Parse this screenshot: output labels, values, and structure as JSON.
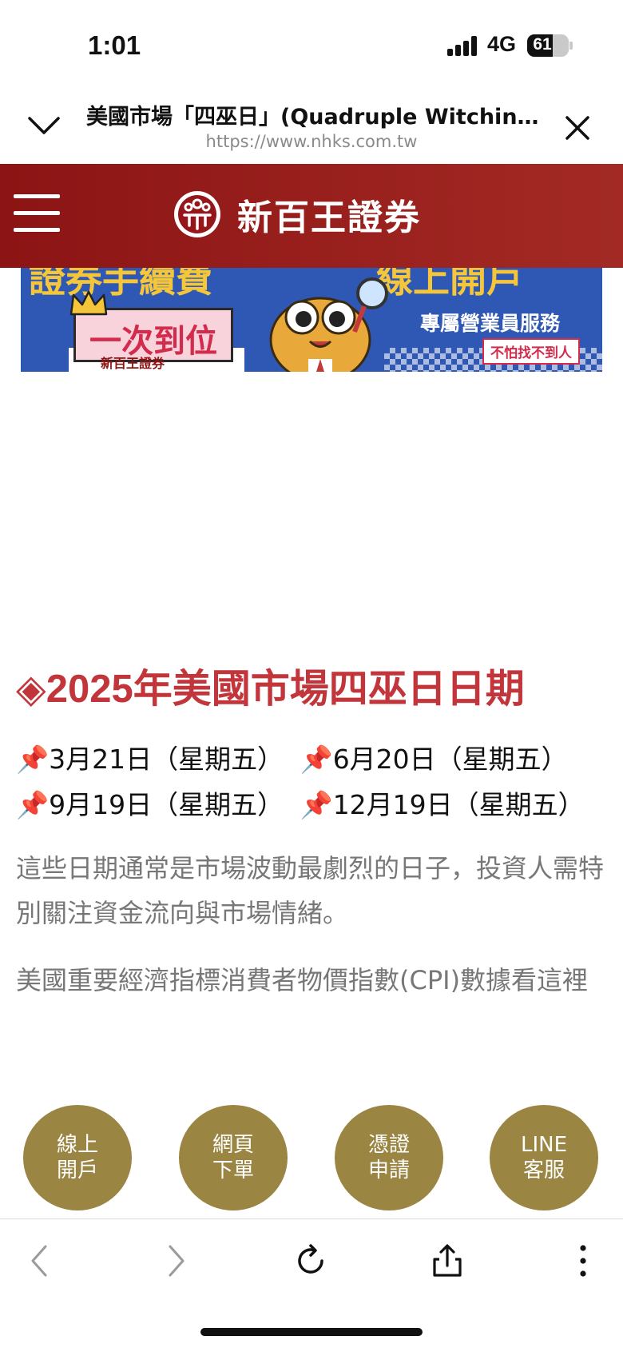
{
  "status_bar": {
    "time": "1:01",
    "network": "4G",
    "battery_level": "61"
  },
  "url_bar": {
    "page_title": "美國市場「四巫日」(Quadruple Witchin...",
    "url": "https://www.nhks.com.tw"
  },
  "site_header": {
    "brand_name": "新百王證券",
    "brand_color": "#8c1414"
  },
  "banner": {
    "headline_left": "證券手續費",
    "headline_right": "線上開戶",
    "pink_box_text": "一次到位",
    "mini_brand": "新百王證券",
    "subtitle": "專屬營業員服務",
    "tag": "不怕找不到人"
  },
  "article": {
    "heading_marker": "◈",
    "heading_text": "2025年美國市場四巫日日期",
    "heading_color": "#c1353b",
    "dates": [
      "3月21日（星期五）",
      "6月20日（星期五）",
      "9月19日（星期五）",
      "12月19日（星期五）"
    ],
    "pin_icon": "pushpin-icon",
    "paragraph_1": "這些日期通常是市場波動最劇烈的日子，投資人需特別關注資金流向與市場情緒。",
    "paragraph_2": "美國重要經濟指標消費者物價指數(CPI)數據看這裡"
  },
  "quick_actions": [
    {
      "line1": "線上",
      "line2": "開戶"
    },
    {
      "line1": "網頁",
      "line2": "下單"
    },
    {
      "line1": "憑證",
      "line2": "申請"
    },
    {
      "line1": "LINE",
      "line2": "客服"
    }
  ],
  "quick_action_color": "#9b8542",
  "toolbar": {
    "icons": [
      "back-icon",
      "forward-icon",
      "reload-icon",
      "share-icon",
      "more-icon"
    ]
  }
}
